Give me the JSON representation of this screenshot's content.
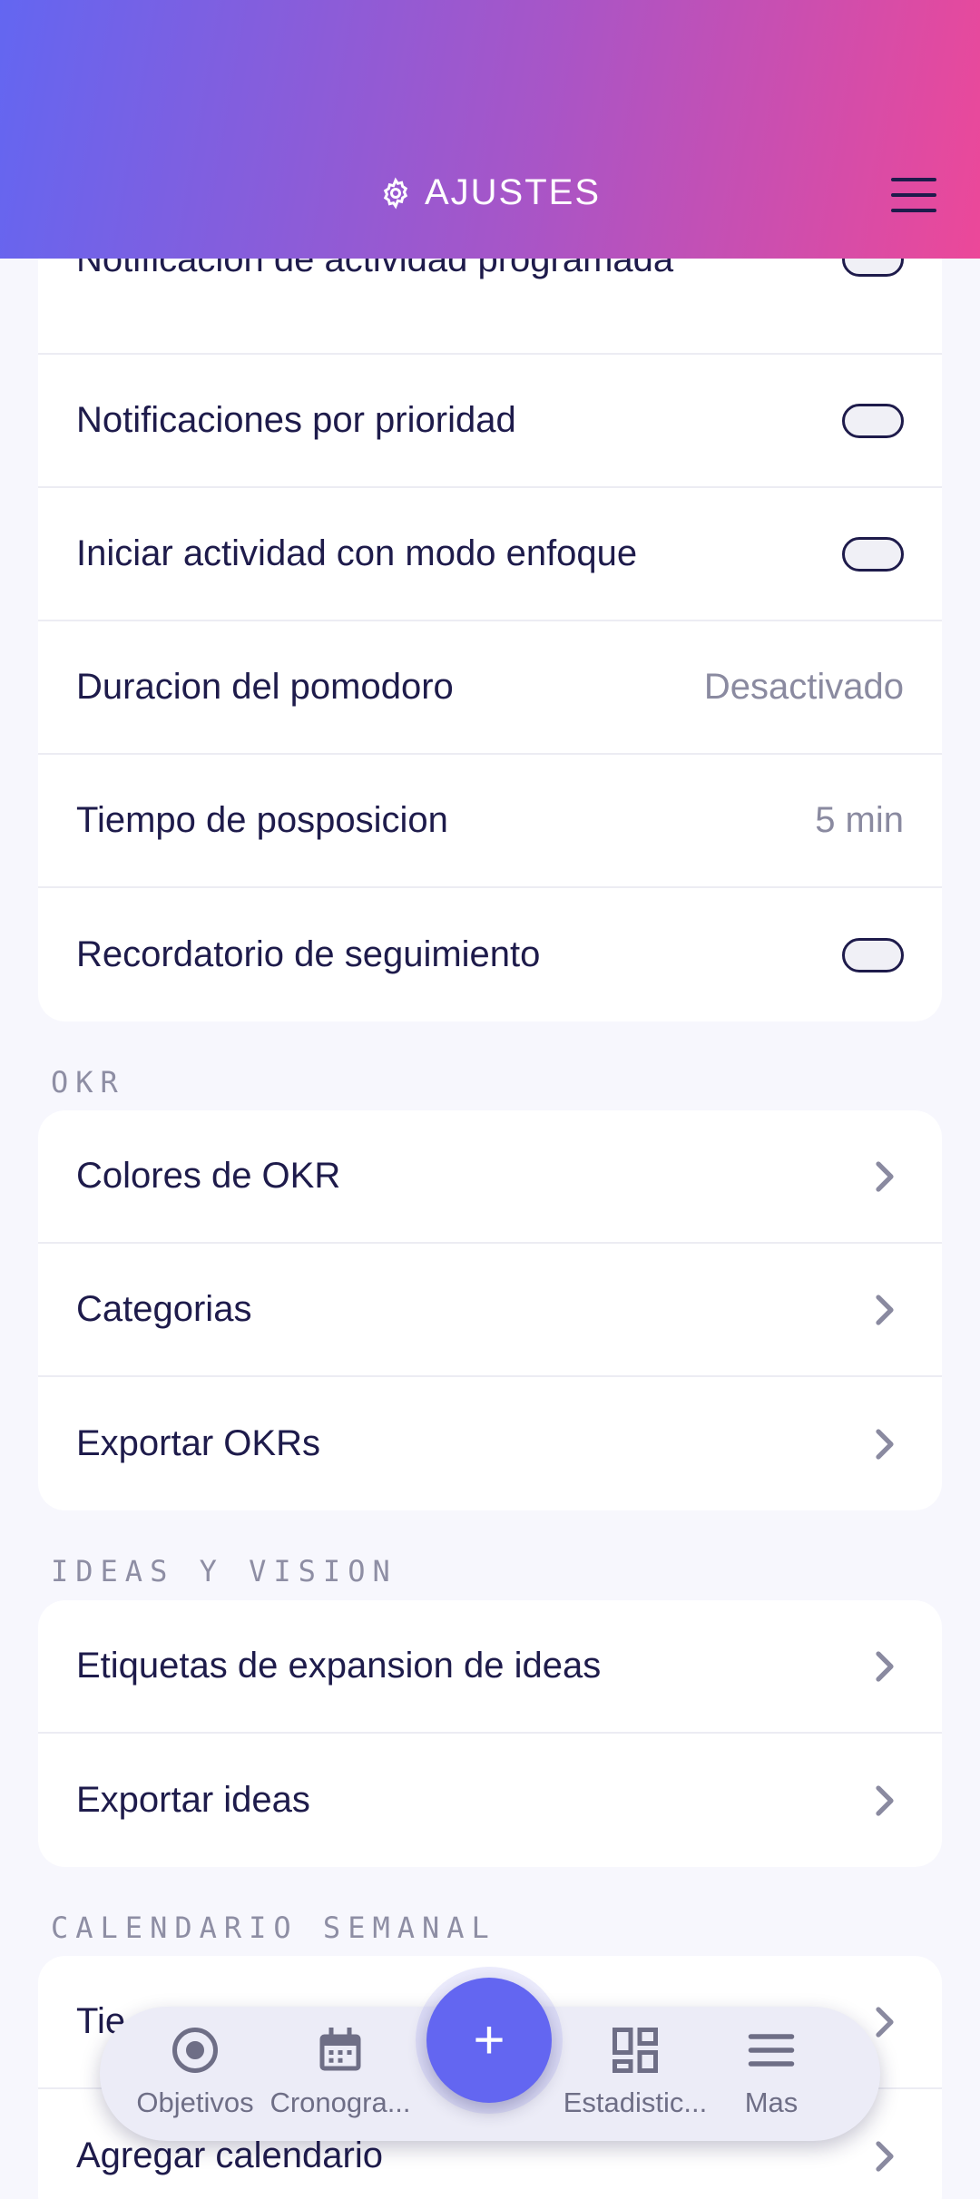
{
  "header": {
    "title": "AJUSTES"
  },
  "notifications": [
    {
      "label": "Notificacion de actividad programada",
      "control": "toggle"
    },
    {
      "label": "Notificaciones por prioridad",
      "control": "toggle"
    },
    {
      "label": "Iniciar actividad con modo enfoque",
      "control": "toggle"
    },
    {
      "label": "Duracion del pomodoro",
      "value": "Desactivado"
    },
    {
      "label": "Tiempo de posposicion",
      "value": "5 min"
    },
    {
      "label": "Recordatorio de seguimiento",
      "control": "toggle"
    }
  ],
  "okr": {
    "section_title": "OKR",
    "items": [
      "Colores de OKR",
      "Categorias",
      "Exportar OKRs"
    ]
  },
  "ideas": {
    "section_title": "IDEAS Y VISION",
    "items": [
      "Etiquetas de expansion de ideas",
      "Exportar ideas"
    ]
  },
  "calendar": {
    "section_title": "CALENDARIO SEMANAL",
    "items": [
      "Tie",
      "Agregar calendario"
    ]
  },
  "bottom_nav": {
    "items": [
      {
        "label": "Objetivos",
        "icon": "target-icon"
      },
      {
        "label": "Cronogra...",
        "icon": "calendar-icon"
      },
      {
        "label": "Estadistic...",
        "icon": "dashboard-icon"
      },
      {
        "label": "Mas",
        "icon": "menu-icon"
      }
    ],
    "fab_label": "+"
  },
  "colors": {
    "accent": "#6366f1",
    "gradient_start": "#6366f1",
    "gradient_end": "#ec4899"
  }
}
